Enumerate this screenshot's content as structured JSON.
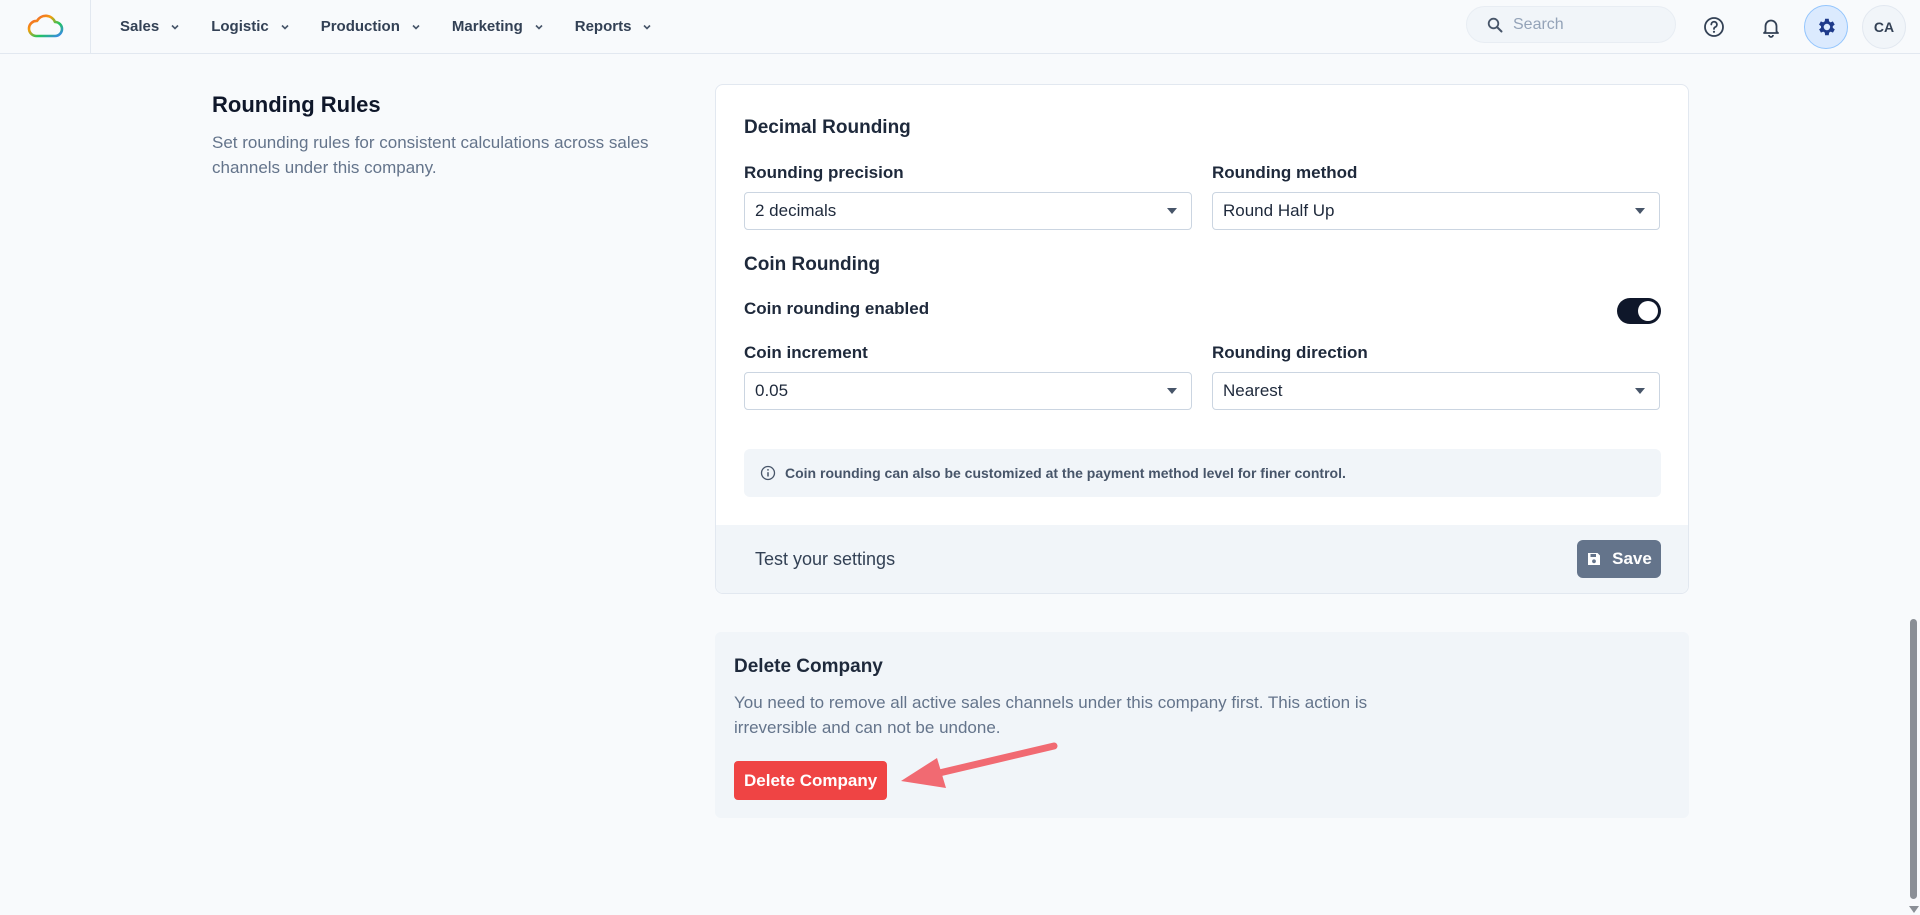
{
  "nav": {
    "items": [
      {
        "label": "Sales"
      },
      {
        "label": "Logistic"
      },
      {
        "label": "Production"
      },
      {
        "label": "Marketing"
      },
      {
        "label": "Reports"
      }
    ],
    "search_placeholder": "Search",
    "avatar_initials": "CA"
  },
  "section": {
    "title": "Rounding Rules",
    "description": "Set rounding rules for consistent calculations across sales channels under this company."
  },
  "decimal": {
    "title": "Decimal Rounding",
    "precision_label": "Rounding precision",
    "precision_value": "2 decimals",
    "method_label": "Rounding method",
    "method_value": "Round Half Up"
  },
  "coin": {
    "title": "Coin Rounding",
    "enabled_label": "Coin rounding enabled",
    "enabled": true,
    "increment_label": "Coin increment",
    "increment_value": "0.05",
    "direction_label": "Rounding direction",
    "direction_value": "Nearest",
    "info_text": "Coin rounding can also be customized at the payment method level for finer control."
  },
  "footer": {
    "test_label": "Test your settings",
    "save_label": "Save"
  },
  "danger": {
    "title": "Delete Company",
    "description": "You need to remove all active sales channels under this company first. This action is irreversible and can not be undone.",
    "button_label": "Delete Company"
  },
  "colors": {
    "accent_dark": "#0f172a",
    "danger": "#ef4444",
    "arrow": "#f16a72",
    "save_button": "#64748b"
  },
  "icons": [
    "cloud-logo",
    "chevron-down-icon",
    "search-icon",
    "help-icon",
    "bell-icon",
    "gear-icon",
    "info-icon",
    "save-icon",
    "arrow-annotation"
  ]
}
